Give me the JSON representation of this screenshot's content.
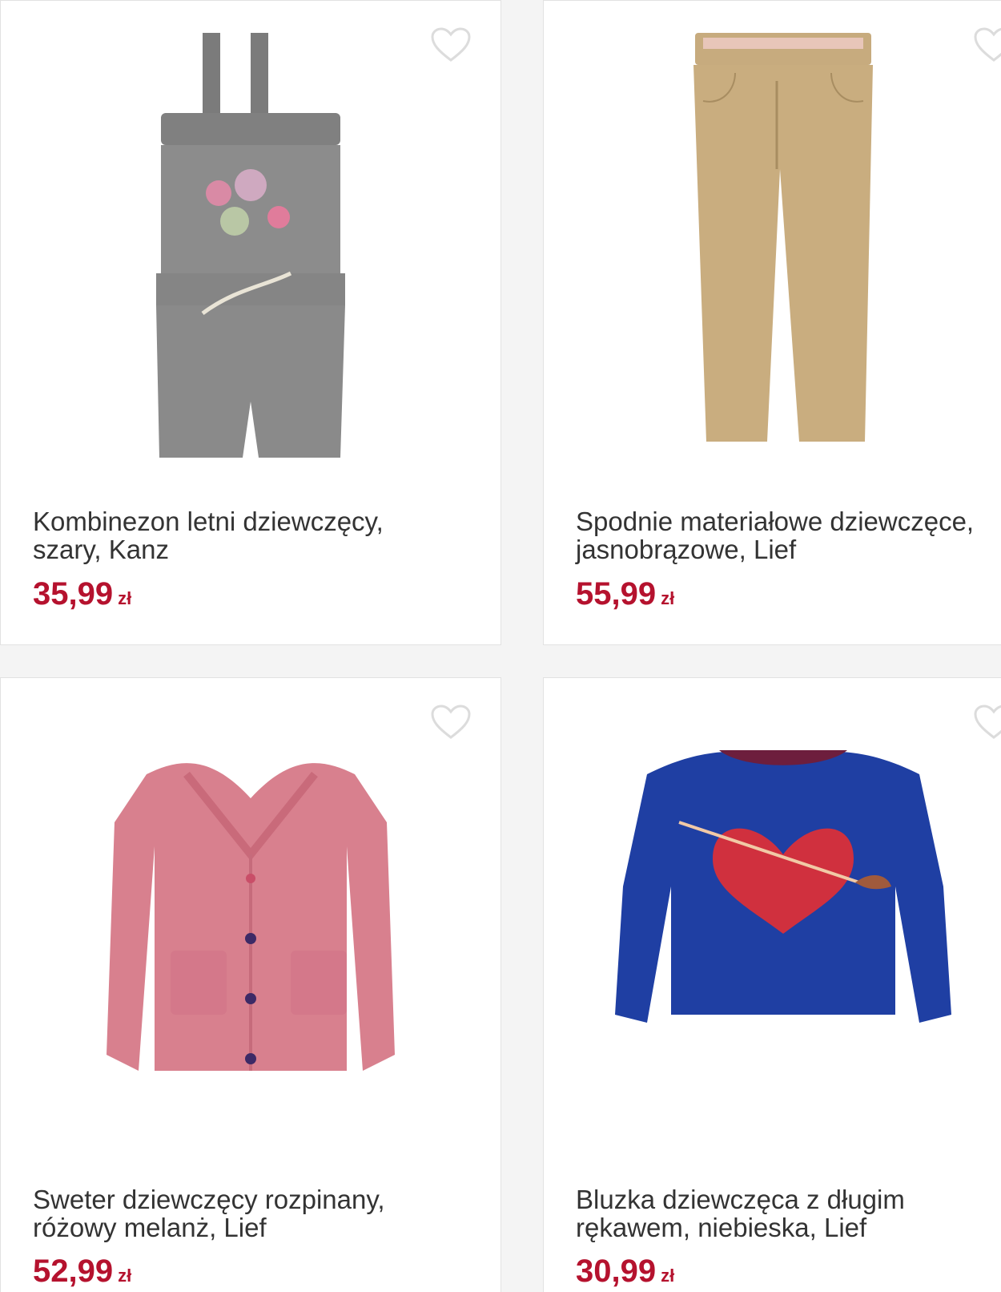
{
  "products": [
    {
      "title_line1": "Kombinezon letni dziewczęcy,",
      "title_line2": "szary, Kanz",
      "price": "35,99",
      "currency": "zł",
      "icon": "heart-outline-icon"
    },
    {
      "title_line1": "Spodnie materiałowe dziewczęce,",
      "title_line2": "jasnobrązowe, Lief",
      "price": "55,99",
      "currency": "zł",
      "icon": "heart-outline-icon"
    },
    {
      "title_line1": "Sweter dziewczęcy rozpinany,",
      "title_line2": "różowy melanż, Lief",
      "price": "52,99",
      "currency": "zł",
      "icon": "heart-outline-icon"
    },
    {
      "title_line1": "Bluzka dziewczęca z długim",
      "title_line2": "rękawem, niebieska, Lief",
      "price": "30,99",
      "currency": "zł",
      "icon": "heart-outline-icon"
    }
  ],
  "colors": {
    "price": "#b5122e",
    "text": "#333333",
    "heart": "#dddddd"
  }
}
